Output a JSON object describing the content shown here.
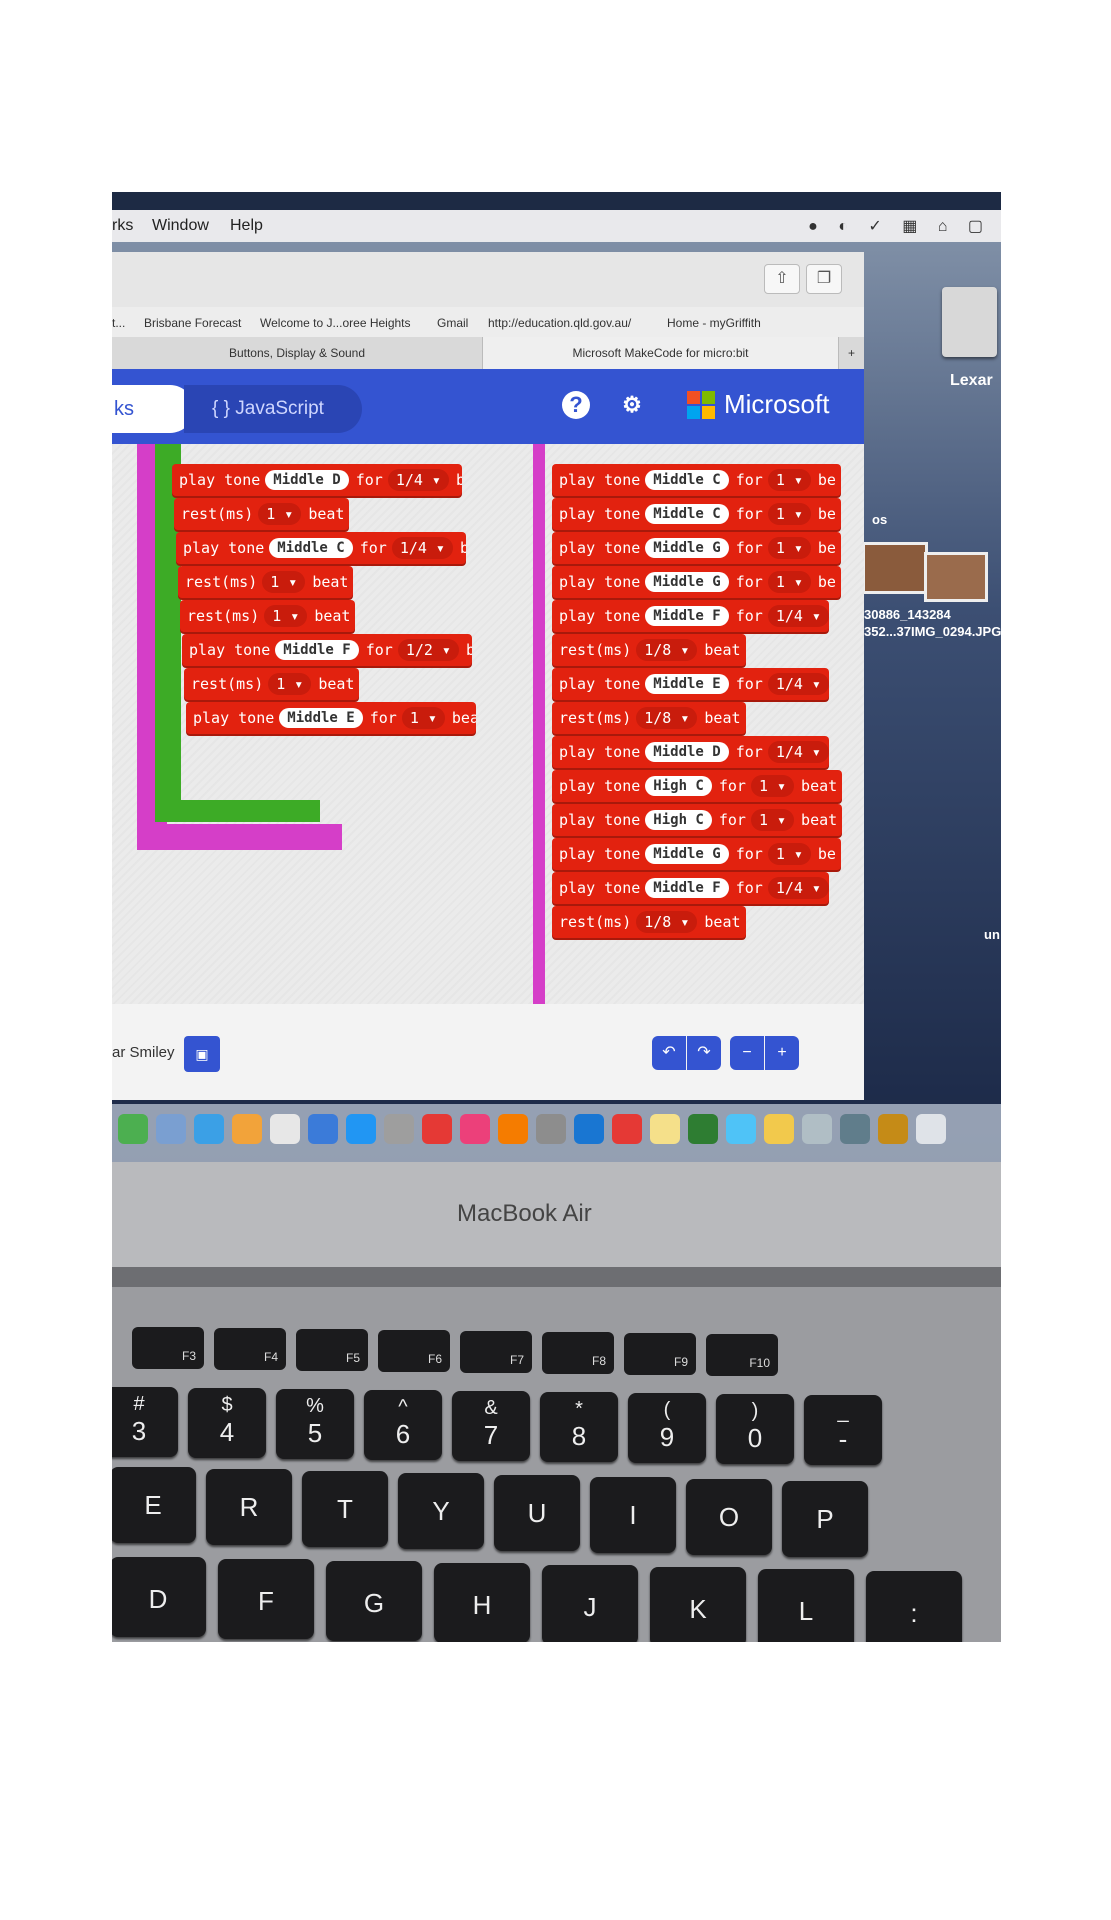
{
  "menubar": {
    "items": [
      "rks",
      "Window",
      "Help"
    ]
  },
  "desktop": {
    "drive_label": "Lexar",
    "file1": "30886_143284",
    "file2": "352...37IMG_0294.JPG",
    "side_text_os": "os",
    "side_text_un": "un"
  },
  "browser": {
    "bookmarks": [
      "t...",
      "Brisbane Forecast",
      "Welcome to J...oree Heights",
      "Gmail",
      "http://education.qld.gov.au/",
      "Home - myGriffith"
    ],
    "tabs": [
      "Buttons, Display & Sound",
      "Microsoft MakeCode for micro:bit"
    ],
    "new_tab": "+"
  },
  "makecode": {
    "blocks_tab": "ks",
    "js_tab": "{ } JavaScript",
    "help_icon": "?",
    "settings_icon": "⚙",
    "brand": "Microsoft",
    "brand_colors": [
      "#f25022",
      "#7fba00",
      "#00a4ef",
      "#ffb900"
    ],
    "project_name": "ar Smiley",
    "left_column": [
      {
        "verb": "play tone",
        "note": "Middle D",
        "for": "for",
        "dur": "1/4 ▾",
        "unit": "beat"
      },
      {
        "verb": "rest(ms)",
        "dur": "1 ▾",
        "unit": "beat"
      },
      {
        "verb": "play tone",
        "note": "Middle C",
        "for": "for",
        "dur": "1/4 ▾",
        "unit": "beat"
      },
      {
        "verb": "rest(ms)",
        "dur": "1 ▾",
        "unit": "beat"
      },
      {
        "verb": "rest(ms)",
        "dur": "1 ▾",
        "unit": "beat"
      },
      {
        "verb": "play tone",
        "note": "Middle F",
        "for": "for",
        "dur": "1/2 ▾",
        "unit": "beat"
      },
      {
        "verb": "rest(ms)",
        "dur": "1 ▾",
        "unit": "beat"
      },
      {
        "verb": "play tone",
        "note": "Middle E",
        "for": "for",
        "dur": "1 ▾",
        "unit": "beat"
      }
    ],
    "right_column": [
      {
        "verb": "play tone",
        "note": "Middle C",
        "for": "for",
        "dur": "1 ▾",
        "unit": "be"
      },
      {
        "verb": "play tone",
        "note": "Middle C",
        "for": "for",
        "dur": "1 ▾",
        "unit": "be"
      },
      {
        "verb": "play tone",
        "note": "Middle G",
        "for": "for",
        "dur": "1 ▾",
        "unit": "be"
      },
      {
        "verb": "play tone",
        "note": "Middle G",
        "for": "for",
        "dur": "1 ▾",
        "unit": "be"
      },
      {
        "verb": "play tone",
        "note": "Middle F",
        "for": "for",
        "dur": "1/4 ▾",
        "unit": ""
      },
      {
        "verb": "rest(ms)",
        "dur": "1/8 ▾",
        "unit": "beat"
      },
      {
        "verb": "play tone",
        "note": "Middle E",
        "for": "for",
        "dur": "1/4 ▾",
        "unit": ""
      },
      {
        "verb": "rest(ms)",
        "dur": "1/8 ▾",
        "unit": "beat"
      },
      {
        "verb": "play tone",
        "note": "Middle D",
        "for": "for",
        "dur": "1/4 ▾",
        "unit": ""
      },
      {
        "verb": "play tone",
        "note": "High C",
        "for": "for",
        "dur": "1 ▾",
        "unit": "beat"
      },
      {
        "verb": "play tone",
        "note": "High C",
        "for": "for",
        "dur": "1 ▾",
        "unit": "beat"
      },
      {
        "verb": "play tone",
        "note": "Middle G",
        "for": "for",
        "dur": "1 ▾",
        "unit": "be"
      },
      {
        "verb": "play tone",
        "note": "Middle F",
        "for": "for",
        "dur": "1/4 ▾",
        "unit": ""
      },
      {
        "verb": "rest(ms)",
        "dur": "1/8 ▾",
        "unit": "beat"
      }
    ],
    "controls": [
      "↶",
      "↷",
      "−",
      "+"
    ]
  },
  "laptop": {
    "brand_label": "MacBook Air",
    "fkeys": [
      "F3",
      "F4",
      "F5",
      "F6",
      "F7",
      "F8",
      "F9",
      "F10"
    ],
    "number_keys": [
      {
        "top": "#",
        "main": "3"
      },
      {
        "top": "$",
        "main": "4"
      },
      {
        "top": "%",
        "main": "5"
      },
      {
        "top": "^",
        "main": "6"
      },
      {
        "top": "&",
        "main": "7"
      },
      {
        "top": "*",
        "main": "8"
      },
      {
        "top": "(",
        "main": "9"
      },
      {
        "top": ")",
        "main": "0"
      },
      {
        "top": "_",
        "main": "-"
      }
    ],
    "row_q": [
      "E",
      "R",
      "T",
      "Y",
      "U",
      "I",
      "O",
      "P"
    ],
    "row_a": [
      "D",
      "F",
      "G",
      "H",
      "J",
      "K",
      "L",
      ":"
    ]
  }
}
